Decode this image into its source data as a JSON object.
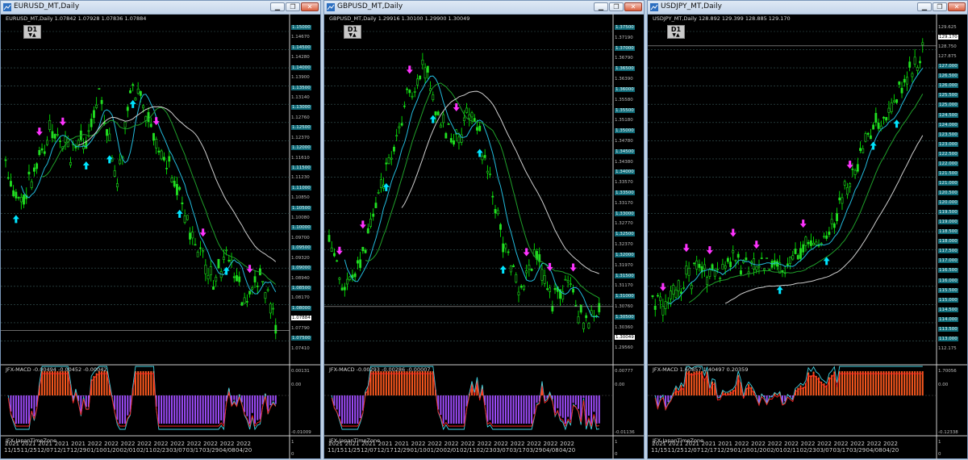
{
  "windows": [
    {
      "key": "eurusd",
      "title": "EURUSD_MT,Daily",
      "header_quote": "EURUSD_MT,Daily  1.07842 1.07928 1.07836 1.07884",
      "timeframe": "D1",
      "macd_label": "JFX-MACD -0.00494 -0.00452 -0.00042",
      "time_zone_label": "JFX-JapanTimeZone",
      "macd_scale": [
        "0.00131",
        "0.00",
        "-0.01009"
      ],
      "zone_scale": [
        "1",
        "0"
      ],
      "price_labels": [
        {
          "text": "1.15000",
          "boxed": true
        },
        {
          "text": "1.14670",
          "boxed": false
        },
        {
          "text": "1.14500",
          "boxed": true
        },
        {
          "text": "1.14280",
          "boxed": false
        },
        {
          "text": "1.14000",
          "boxed": true
        },
        {
          "text": "1.13900",
          "boxed": false
        },
        {
          "text": "1.13500",
          "boxed": true
        },
        {
          "text": "1.13140",
          "boxed": false
        },
        {
          "text": "1.13000",
          "boxed": true
        },
        {
          "text": "1.12760",
          "boxed": false
        },
        {
          "text": "1.12500",
          "boxed": true
        },
        {
          "text": "1.12370",
          "boxed": false
        },
        {
          "text": "1.12000",
          "boxed": true
        },
        {
          "text": "1.11610",
          "boxed": false
        },
        {
          "text": "1.11500",
          "boxed": true
        },
        {
          "text": "1.11230",
          "boxed": false
        },
        {
          "text": "1.11000",
          "boxed": true
        },
        {
          "text": "1.10850",
          "boxed": false
        },
        {
          "text": "1.10500",
          "boxed": true
        },
        {
          "text": "1.10080",
          "boxed": false
        },
        {
          "text": "1.10000",
          "boxed": true
        },
        {
          "text": "1.09700",
          "boxed": false
        },
        {
          "text": "1.09500",
          "boxed": true
        },
        {
          "text": "1.09320",
          "boxed": false
        },
        {
          "text": "1.09000",
          "boxed": true
        },
        {
          "text": "1.08940",
          "boxed": false
        },
        {
          "text": "1.08500",
          "boxed": true
        },
        {
          "text": "1.08170",
          "boxed": false
        },
        {
          "text": "1.08000",
          "boxed": true
        },
        {
          "text": "1.07884",
          "cur": true
        },
        {
          "text": "1.07790",
          "boxed": false
        },
        {
          "text": "1.07500",
          "boxed": true
        },
        {
          "text": "1.07410",
          "boxed": false
        }
      ],
      "dates": [
        "2021\n11/15",
        "2021\n11/25",
        "2021\n12/07",
        "2021\n12/17",
        "2021\n12/29",
        "2022\n01/10",
        "2022\n01/20",
        "2022\n02/01",
        "2022\n02/11",
        "2022\n02/23",
        "2022\n03/07",
        "2022\n03/17",
        "2022\n03/29",
        "2022\n04/08",
        "2022\n04/20"
      ]
    },
    {
      "key": "gbpusd",
      "title": "GBPUSD_MT,Daily",
      "header_quote": "GBPUSD_MT,Daily  1.29916 1.30100 1.29900 1.30049",
      "timeframe": "D1",
      "macd_label": "JFX-MACD -0.00293 -0.00286 -0.00007",
      "time_zone_label": "JFX-JapanTimeZone",
      "macd_scale": [
        "0.00777",
        "0.00",
        "-0.01136"
      ],
      "zone_scale": [
        "1",
        "0"
      ],
      "price_labels": [
        {
          "text": "1.37500",
          "boxed": true
        },
        {
          "text": "1.37190",
          "boxed": false
        },
        {
          "text": "1.37000",
          "boxed": true
        },
        {
          "text": "1.36790",
          "boxed": false
        },
        {
          "text": "1.36500",
          "boxed": true
        },
        {
          "text": "1.36390",
          "boxed": false
        },
        {
          "text": "1.36000",
          "boxed": true
        },
        {
          "text": "1.35580",
          "boxed": false
        },
        {
          "text": "1.35500",
          "boxed": true
        },
        {
          "text": "1.35180",
          "boxed": false
        },
        {
          "text": "1.35000",
          "boxed": true
        },
        {
          "text": "1.34780",
          "boxed": false
        },
        {
          "text": "1.34500",
          "boxed": true
        },
        {
          "text": "1.34380",
          "boxed": false
        },
        {
          "text": "1.34000",
          "boxed": true
        },
        {
          "text": "1.33570",
          "boxed": false
        },
        {
          "text": "1.33500",
          "boxed": true
        },
        {
          "text": "1.33170",
          "boxed": false
        },
        {
          "text": "1.33000",
          "boxed": true
        },
        {
          "text": "1.32770",
          "boxed": false
        },
        {
          "text": "1.32500",
          "boxed": true
        },
        {
          "text": "1.32370",
          "boxed": false
        },
        {
          "text": "1.32000",
          "boxed": true
        },
        {
          "text": "1.31970",
          "boxed": false
        },
        {
          "text": "1.31500",
          "boxed": true
        },
        {
          "text": "1.31170",
          "boxed": false
        },
        {
          "text": "1.31000",
          "boxed": true
        },
        {
          "text": "1.30760",
          "boxed": false
        },
        {
          "text": "1.30500",
          "boxed": true
        },
        {
          "text": "1.30360",
          "boxed": false
        },
        {
          "text": "1.30049",
          "cur": true
        },
        {
          "text": "1.29560",
          "boxed": false
        }
      ],
      "dates": [
        "2021\n11/15",
        "2021\n11/25",
        "2021\n12/07",
        "2021\n12/17",
        "2021\n12/29",
        "2022\n01/10",
        "2022\n01/20",
        "2022\n02/01",
        "2022\n02/11",
        "2022\n02/23",
        "2022\n03/07",
        "2022\n03/17",
        "2022\n03/29",
        "2022\n04/08",
        "2022\n04/20"
      ]
    },
    {
      "key": "usdjpy",
      "title": "USDJPY_MT,Daily",
      "header_quote": "USDJPY_MT,Daily  128.892 129.399 128.885 129.170",
      "timeframe": "D1",
      "macd_label": "JFX-MACD 1.60857 1.40497 0.20359",
      "time_zone_label": "JFX-JapanTimeZone",
      "macd_scale": [
        "1.70056",
        "0.00",
        "-0.12338"
      ],
      "zone_scale": [
        "1",
        "0"
      ],
      "price_labels": [
        {
          "text": "129.625",
          "boxed": false
        },
        {
          "text": "129.170",
          "cur": true
        },
        {
          "text": "128.750",
          "boxed": false
        },
        {
          "text": "127.875",
          "boxed": false
        },
        {
          "text": "127.000",
          "boxed": true
        },
        {
          "text": "126.500",
          "boxed": true
        },
        {
          "text": "126.000",
          "boxed": true
        },
        {
          "text": "125.500",
          "boxed": true
        },
        {
          "text": "125.000",
          "boxed": true
        },
        {
          "text": "124.500",
          "boxed": true
        },
        {
          "text": "124.000",
          "boxed": true
        },
        {
          "text": "123.500",
          "boxed": true
        },
        {
          "text": "123.000",
          "boxed": true
        },
        {
          "text": "122.500",
          "boxed": true
        },
        {
          "text": "122.000",
          "boxed": true
        },
        {
          "text": "121.500",
          "boxed": true
        },
        {
          "text": "121.000",
          "boxed": true
        },
        {
          "text": "120.500",
          "boxed": true
        },
        {
          "text": "120.000",
          "boxed": true
        },
        {
          "text": "119.500",
          "boxed": true
        },
        {
          "text": "119.000",
          "boxed": true
        },
        {
          "text": "118.500",
          "boxed": true
        },
        {
          "text": "118.000",
          "boxed": true
        },
        {
          "text": "117.500",
          "boxed": true
        },
        {
          "text": "117.000",
          "boxed": true
        },
        {
          "text": "116.500",
          "boxed": true
        },
        {
          "text": "116.000",
          "boxed": true
        },
        {
          "text": "115.500",
          "boxed": true
        },
        {
          "text": "115.000",
          "boxed": true
        },
        {
          "text": "114.500",
          "boxed": true
        },
        {
          "text": "114.000",
          "boxed": true
        },
        {
          "text": "113.500",
          "boxed": true
        },
        {
          "text": "113.000",
          "boxed": true
        },
        {
          "text": "112.175",
          "boxed": false
        }
      ],
      "dates": [
        "2021\n11/15",
        "2021\n11/25",
        "2021\n12/07",
        "2021\n12/17",
        "2021\n12/29",
        "2022\n01/10",
        "2022\n01/20",
        "2022\n02/01",
        "2022\n02/11",
        "2022\n02/23",
        "2022\n03/07",
        "2022\n03/17",
        "2022\n03/29",
        "2022\n04/08",
        "2022\n04/20"
      ]
    }
  ],
  "colors": {
    "bull_candle": "#22dd22",
    "bear_candle": "#00ff00",
    "ma_fast": "#22bbdd",
    "ma_mid": "#1f9f2a",
    "ma_slow": "#cfcfcf",
    "up_arrow": "#00e5ff",
    "down_arrow": "#ff33ff",
    "macd_pos": "#ff5a1f",
    "macd_neg": "#a14dff",
    "signal": "#ff2222",
    "macd_line": "#3fd0e0",
    "grid": "#3a5a5a",
    "price_box": "#0f6a78"
  },
  "icons": [
    "chart-window-icon",
    "minimize-icon",
    "restore-icon",
    "close-icon"
  ]
}
